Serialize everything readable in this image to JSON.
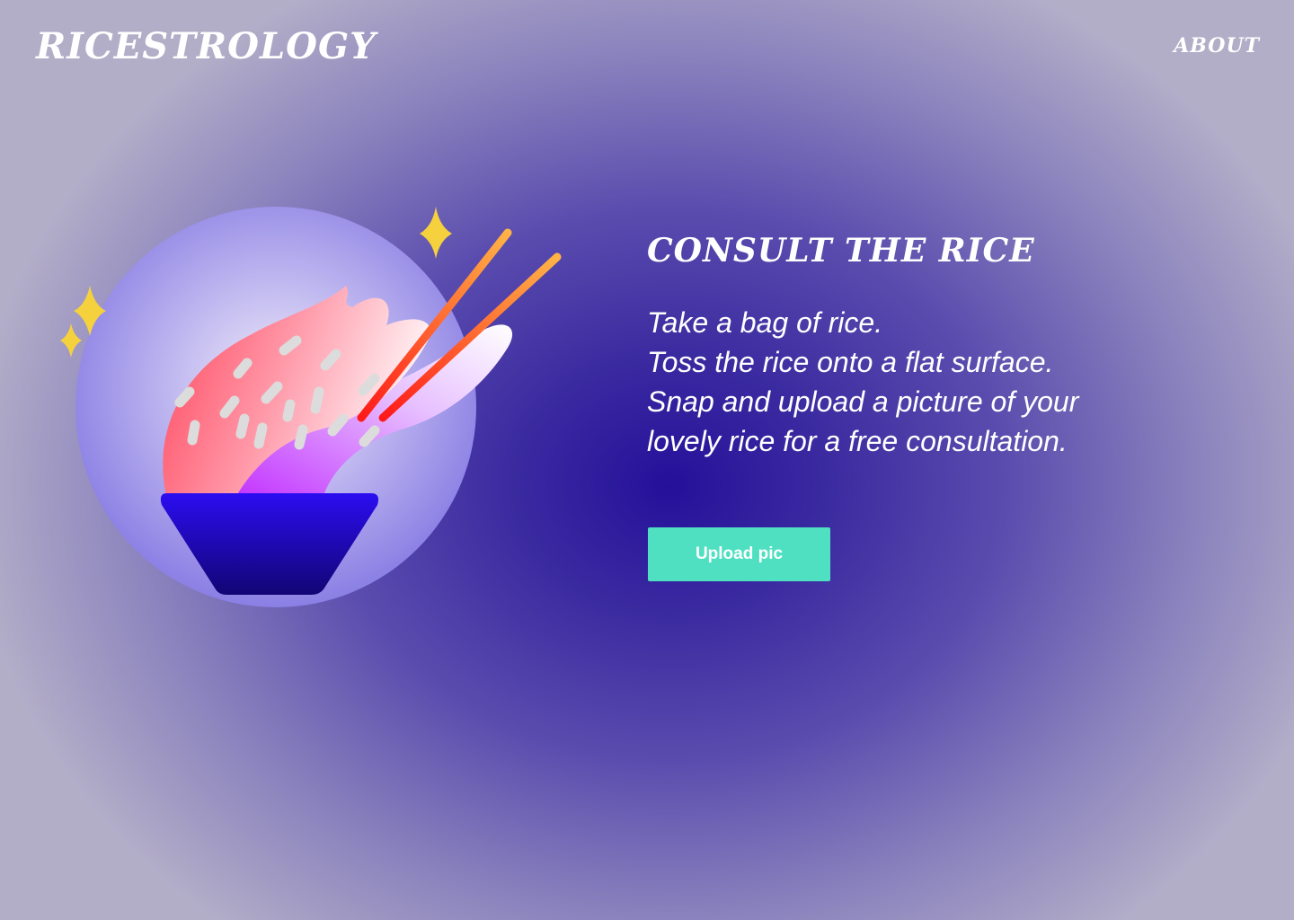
{
  "header": {
    "brand": "RICESTROLOGY",
    "nav_about": "ABOUT"
  },
  "hero": {
    "title": "CONSULT THE RICE",
    "instructions": [
      "Take a bag of rice.",
      "Toss the rice onto a flat surface.",
      "Snap and upload a picture of your",
      "lovely rice for a free consultation."
    ],
    "upload_label": "Upload pic"
  },
  "illustration": {
    "icons": [
      "rice-bowl-icon",
      "chopsticks-icon",
      "sparkle-icon"
    ]
  },
  "colors": {
    "accent": "#4fe0c2",
    "background_center": "#24109a",
    "background_edge": "#b3aec8",
    "sparkle": "#f5d13e",
    "bowl": "#2a0fe0"
  }
}
